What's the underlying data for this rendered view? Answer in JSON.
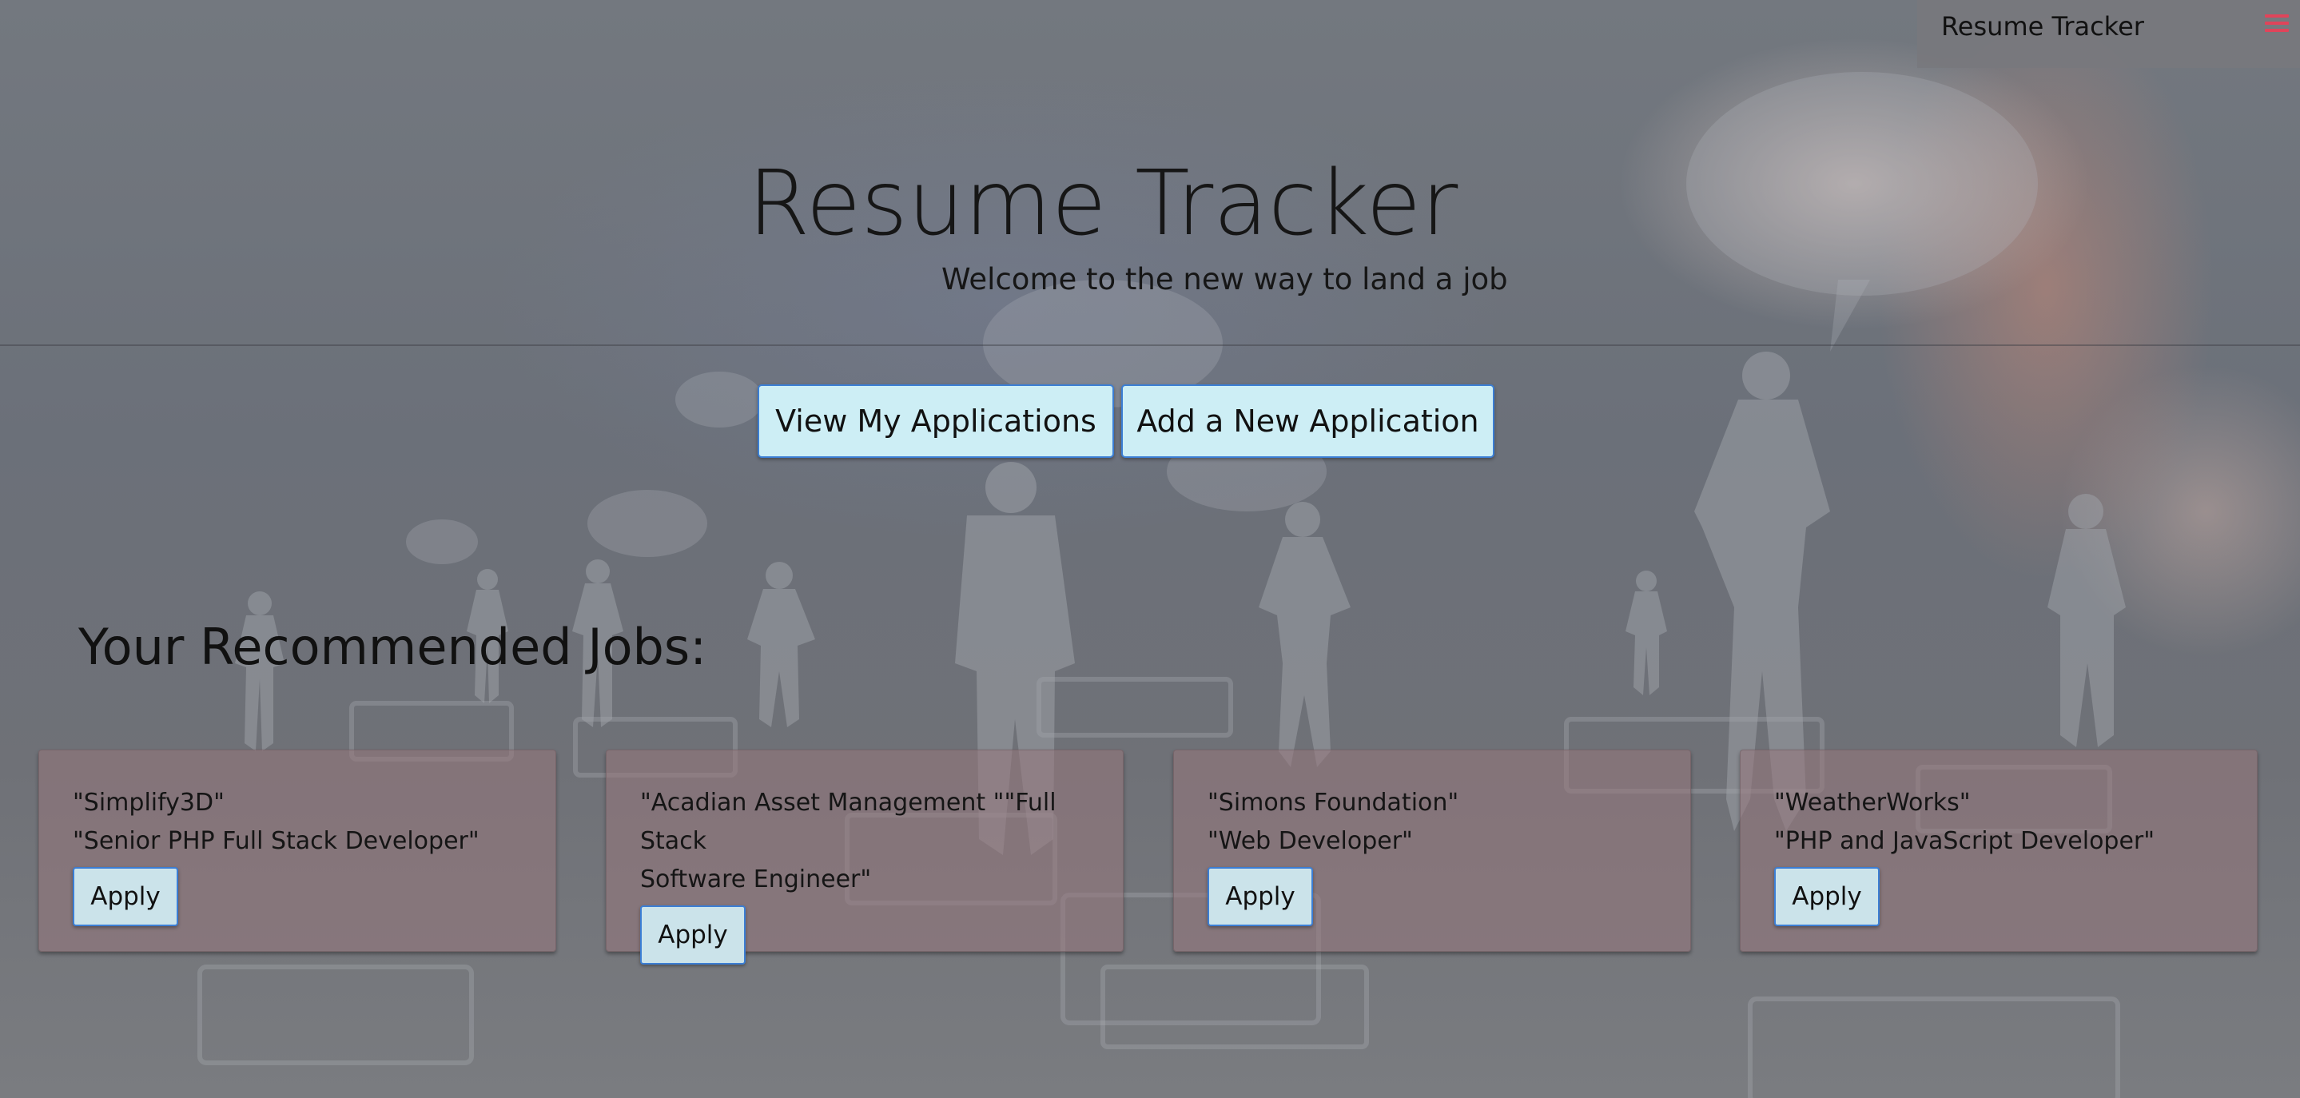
{
  "navbar": {
    "brand": "Resume Tracker",
    "menu_icon": "hamburger-menu-icon",
    "menu_icon_color": "#e0445a"
  },
  "hero": {
    "title": "Resume Tracker",
    "subtitle": "Welcome to the new way to land a job"
  },
  "actions": {
    "view_label": "View My Applications",
    "add_label": "Add a New Application"
  },
  "recommended": {
    "heading": "Your Recommended Jobs:",
    "jobs": [
      {
        "company": "\"Simplify3D\"",
        "title": "\"Senior PHP Full Stack Developer\"",
        "apply_label": "Apply"
      },
      {
        "company": "\"Acadian Asset Management \"\"Full Stack",
        "title": "Software Engineer\"",
        "apply_label": "Apply"
      },
      {
        "company": "\"Simons Foundation\"",
        "title": "\"Web Developer\"",
        "apply_label": "Apply"
      },
      {
        "company": "\"WeatherWorks\"",
        "title": "\"PHP and JavaScript Developer\"",
        "apply_label": "Apply"
      }
    ]
  },
  "colors": {
    "button_bg": "#cdeef5",
    "button_border": "#3b7ed4",
    "card_bg": "#96767c"
  }
}
